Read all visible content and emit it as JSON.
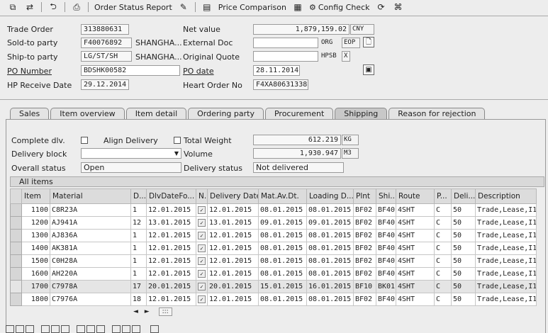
{
  "toolbar": {
    "order_status_report": "Order Status Report",
    "price_comparison": "Price Comparison",
    "config_check": "Config Check",
    "icons": [
      "display-icon",
      "toggle-icon",
      "back-icon",
      "printer-icon",
      "order-icon",
      "table-icon",
      "calc-icon",
      "gear-icon",
      "refresh-icon",
      "tree-icon"
    ]
  },
  "header": {
    "trade_order_label": "Trade Order",
    "trade_order_value": "313880631",
    "sold_to_label": "Sold-to party",
    "sold_to_value": "F40076892",
    "sold_to_name": "SHANGHA...",
    "ship_to_label": "Ship-to party",
    "ship_to_value": "LG/ST/SH",
    "ship_to_name": "SHANGHA...",
    "po_number_label": "PO Number",
    "po_number_value": "BDSHK00582",
    "hp_receive_label": "HP Receive Date",
    "hp_receive_value": "29.12.2014",
    "net_value_label": "Net value",
    "net_value_value": "1,879,159.02",
    "net_value_currency": "CNY",
    "external_doc_label": "External Doc",
    "external_doc_value": "",
    "org_label": "ORG",
    "eop_label": "EOP",
    "original_quote_label": "Original Quote",
    "original_quote_value": "",
    "hpsb_label": "HPSB",
    "x_label": "X",
    "po_date_label": "PO date",
    "po_date_value": "28.11.2014",
    "heart_order_label": "Heart Order No",
    "heart_order_value": "F4XA80631338"
  },
  "tabs": [
    {
      "label": "Sales",
      "active": false
    },
    {
      "label": "Item overview",
      "active": false
    },
    {
      "label": "Item detail",
      "active": false
    },
    {
      "label": "Ordering party",
      "active": false
    },
    {
      "label": "Procurement",
      "active": false
    },
    {
      "label": "Shipping",
      "active": true
    },
    {
      "label": "Reason for rejection",
      "active": false
    }
  ],
  "shipping": {
    "complete_dlv_label": "Complete dlv.",
    "align_delivery_label": "Align Delivery",
    "total_weight_label": "Total Weight",
    "total_weight_value": "612.219",
    "weight_unit": "KG",
    "delivery_block_label": "Delivery block",
    "delivery_block_value": "",
    "volume_label": "Volume",
    "volume_value": "1,930.947",
    "volume_unit": "M3",
    "overall_status_label": "Overall status",
    "overall_status_value": "Open",
    "delivery_status_label": "Delivery status",
    "delivery_status_value": "Not delivered"
  },
  "grid": {
    "title": "All items",
    "columns": [
      "Item",
      "Material",
      "D...",
      "DlvDateFo...",
      "N..",
      "Delivery Date",
      "Mat.Av.Dt.",
      "Loading D...",
      "Plnt",
      "Shi...",
      "Route",
      "P...",
      "Deli...",
      "Description"
    ],
    "rows": [
      [
        "1100",
        "C8R23A",
        "1",
        "12.01.2015",
        "",
        "12.01.2015",
        "08.01.2015",
        "08.01.2015",
        "BF02",
        "BF40",
        "4SHT",
        "C",
        "50",
        "Trade,Lease,I1"
      ],
      [
        "1200",
        "AJ941A",
        "12",
        "13.01.2015",
        "",
        "13.01.2015",
        "09.01.2015",
        "09.01.2015",
        "BF02",
        "BF40",
        "4SHT",
        "C",
        "50",
        "Trade,Lease,I1"
      ],
      [
        "1300",
        "AJ836A",
        "1",
        "12.01.2015",
        "",
        "12.01.2015",
        "08.01.2015",
        "08.01.2015",
        "BF02",
        "BF40",
        "4SHT",
        "C",
        "50",
        "Trade,Lease,I1"
      ],
      [
        "1400",
        "AK381A",
        "1",
        "12.01.2015",
        "",
        "12.01.2015",
        "08.01.2015",
        "08.01.2015",
        "BF02",
        "BF40",
        "4SHT",
        "C",
        "50",
        "Trade,Lease,I1"
      ],
      [
        "1500",
        "C0H28A",
        "1",
        "12.01.2015",
        "",
        "12.01.2015",
        "08.01.2015",
        "08.01.2015",
        "BF02",
        "BF40",
        "4SHT",
        "C",
        "50",
        "Trade,Lease,I1"
      ],
      [
        "1600",
        "AH220A",
        "1",
        "12.01.2015",
        "",
        "12.01.2015",
        "08.01.2015",
        "08.01.2015",
        "BF02",
        "BF40",
        "4SHT",
        "C",
        "50",
        "Trade,Lease,I1"
      ],
      [
        "1700",
        "C7978A",
        "17",
        "20.01.2015",
        "",
        "20.01.2015",
        "15.01.2015",
        "16.01.2015",
        "BF10",
        "BK01",
        "4SHT",
        "C",
        "50",
        "Trade,Lease,I1"
      ],
      [
        "1800",
        "C7976A",
        "18",
        "12.01.2015",
        "",
        "12.01.2015",
        "08.01.2015",
        "08.01.2015",
        "BF02",
        "BF40",
        "4SHT",
        "C",
        "50",
        "Trade,Lease,I1"
      ]
    ]
  },
  "scroll": {
    "left": "◄",
    "right": "►",
    "thumb": ":::"
  }
}
